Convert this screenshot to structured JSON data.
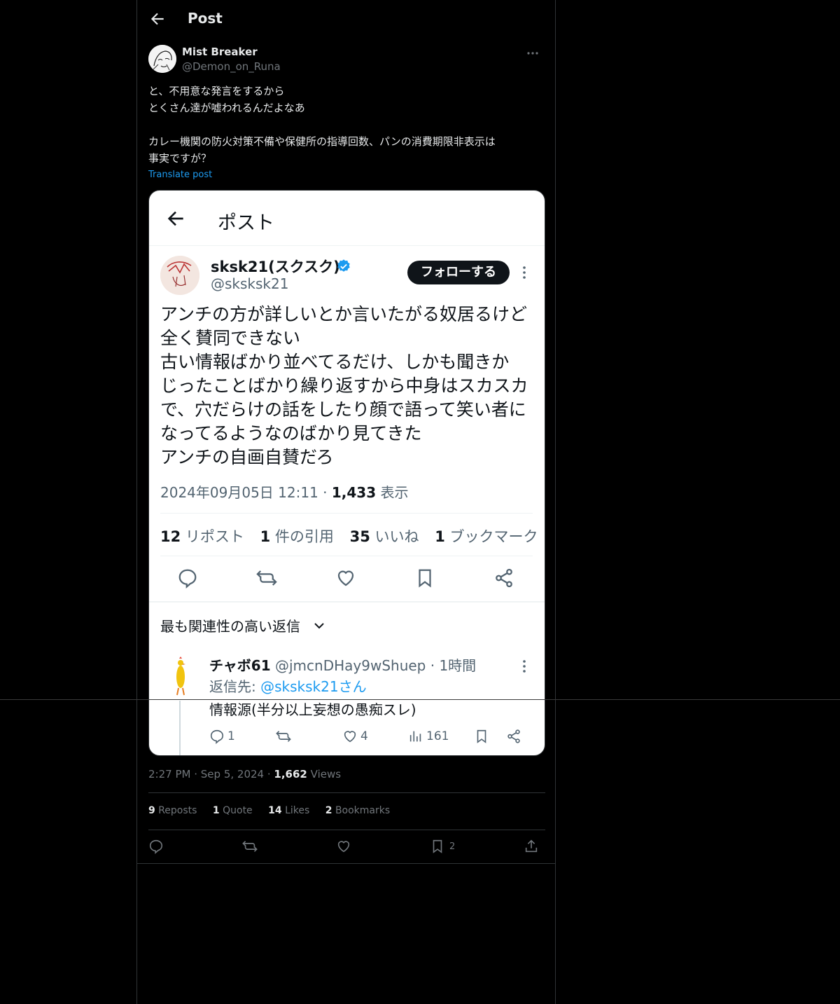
{
  "header": {
    "title": "Post"
  },
  "author": {
    "name": "Mist Breaker",
    "handle": "@Demon_on_Runa"
  },
  "post": {
    "lines": [
      "と、不用意な発言をするから",
      "とくさん達が嘘われるんだよなあ",
      "",
      "カレー機関の防火対策不備や保健所の指導回数、パンの消費期限非表示は",
      "事実ですが？"
    ],
    "translate_label": "Translate post"
  },
  "screenshot": {
    "header_title": "ポスト",
    "author_name": "sksk21(スクスク)",
    "author_handle": "@sksksk21",
    "follow_label": "フォローする",
    "body_lines": [
      "アンチの方が詳しいとか言いたがる奴居るけど",
      "全く賛同できない",
      "古い情報ばかり並べてるだけ、しかも聞きか",
      "じったことばかり繰り返すから中身はスカスカ",
      "で、穴だらけの話をしたり顔で語って笑い者に",
      "なってるようなのばかり見てきた",
      "アンチの自画自賛だろ"
    ],
    "datetime": "2024年09月05日 12:11",
    "views_count": "1,433",
    "views_label": "表示",
    "stats": [
      {
        "count": "12",
        "label": "リポスト"
      },
      {
        "count": "1",
        "label": "件の引用"
      },
      {
        "count": "35",
        "label": "いいね"
      },
      {
        "count": "1",
        "label": "ブックマーク"
      }
    ],
    "sort_label": "最も関連性の高い返信",
    "reply": {
      "name": "チャボ61",
      "handle_time": "@jmcnDHay9wShuep · 1時間",
      "reply_to_prefix": "返信先: ",
      "reply_to": "@sksksk21さん",
      "text": "情報源(半分以上妄想の愚痴スレ)",
      "replies": "1",
      "likes": "4",
      "views": "161"
    }
  },
  "meta": {
    "time": "2:27 PM",
    "date": "Sep 5, 2024",
    "views_count": "1,662",
    "views_label": "Views"
  },
  "stats": [
    {
      "count": "9",
      "label": "Reposts"
    },
    {
      "count": "1",
      "label": "Quote"
    },
    {
      "count": "14",
      "label": "Likes"
    },
    {
      "count": "2",
      "label": "Bookmarks"
    }
  ],
  "actions": {
    "bookmark_count": "2"
  },
  "colors": {
    "accent": "#1d9bf0",
    "background": "#000000",
    "muted": "#71767b"
  }
}
